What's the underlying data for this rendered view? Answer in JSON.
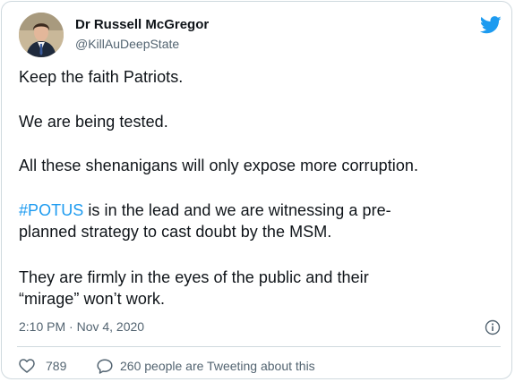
{
  "author": {
    "display_name": "Dr Russell McGregor",
    "handle": "@KillAuDeepState"
  },
  "tweet": {
    "line1": "Keep the faith Patriots.",
    "line2": "We are being tested.",
    "line3": "All these shenanigans will only expose more corruption.",
    "line4_hashtag": "#POTUS",
    "line4_rest": " is in the lead and we are witnessing a pre-",
    "line5": "planned strategy to cast doubt by the MSM.",
    "line6": "They are firmly in the eyes of the public and their",
    "line7": "“mirage” won’t work."
  },
  "meta": {
    "timestamp": "2:10 PM · Nov 4, 2020"
  },
  "actions": {
    "like_count": "789",
    "tweeting_text": "260 people are Tweeting about this"
  },
  "colors": {
    "accent": "#1d9bf0",
    "text": "#0f1419",
    "secondary": "#536471",
    "border": "#cfd9de"
  },
  "icons": {
    "brand": "twitter-bird-icon",
    "info": "info-icon",
    "like": "heart-icon",
    "reply": "speech-bubble-icon"
  }
}
